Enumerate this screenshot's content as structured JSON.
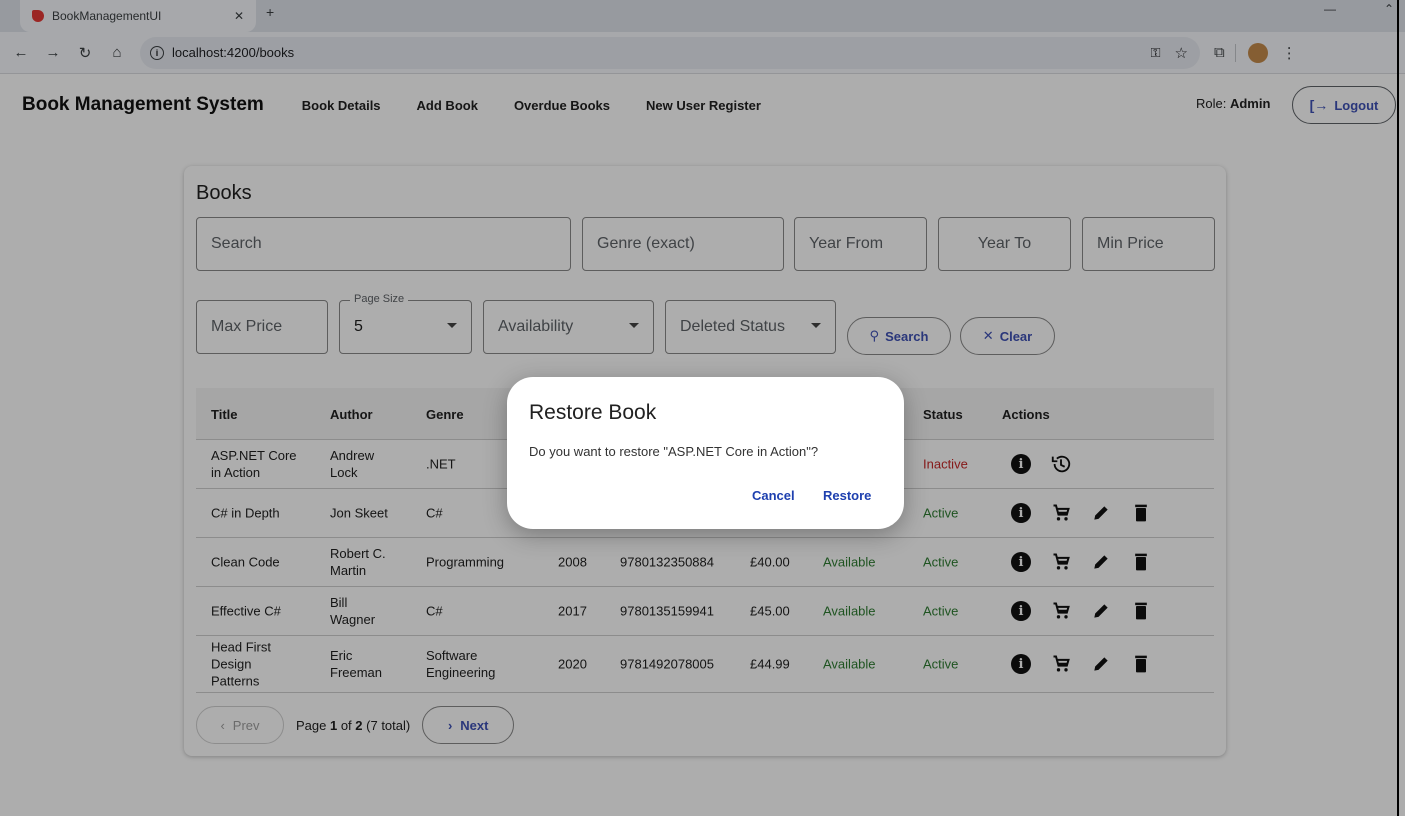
{
  "browser": {
    "tab_title": "BookManagementUI",
    "url": "localhost:4200/books"
  },
  "appbar": {
    "brand": "Book Management System",
    "nav": [
      "Book Details",
      "Add Book",
      "Overdue Books",
      "New User Register"
    ],
    "role_label": "Role: ",
    "role_value": "Admin",
    "logout_label": "Logout"
  },
  "filters": {
    "title": "Books",
    "search_placeholder": "Search",
    "genre_placeholder": "Genre (exact)",
    "year_from_placeholder": "Year From",
    "year_to_placeholder": "Year To",
    "min_price_placeholder": "Min Price",
    "max_price_placeholder": "Max Price",
    "page_size_label": "Page Size",
    "page_size_value": "5",
    "availability_placeholder": "Availability",
    "deleted_status_placeholder": "Deleted Status",
    "search_button": "Search",
    "clear_button": "Clear"
  },
  "table": {
    "headers": {
      "title": "Title",
      "author": "Author",
      "genre": "Genre",
      "status": "Status",
      "actions": "Actions"
    },
    "rows": [
      {
        "title": [
          "ASP.NET Core",
          "in Action"
        ],
        "author": [
          "Andrew",
          "Lock"
        ],
        "genre": [
          ".NET"
        ],
        "year": "",
        "isbn": "",
        "price": "",
        "availability": "",
        "status": "Inactive",
        "deleted": true
      },
      {
        "title": [
          "C# in Depth"
        ],
        "author": [
          "Jon Skeet"
        ],
        "genre": [
          "C#"
        ],
        "year": "",
        "isbn": "",
        "price": "",
        "availability": "",
        "status": "Active",
        "deleted": false
      },
      {
        "title": [
          "Clean Code"
        ],
        "author": [
          "Robert C.",
          "Martin"
        ],
        "genre": [
          "Programming"
        ],
        "year": "2008",
        "isbn": "9780132350884",
        "price": "£40.00",
        "availability": "Available",
        "status": "Active",
        "deleted": false
      },
      {
        "title": [
          "Effective C#"
        ],
        "author": [
          "Bill",
          "Wagner"
        ],
        "genre": [
          "C#"
        ],
        "year": "2017",
        "isbn": "9780135159941",
        "price": "£45.00",
        "availability": "Available",
        "status": "Active",
        "deleted": false
      },
      {
        "title": [
          "Head First",
          "Design",
          "Patterns"
        ],
        "author": [
          "Eric",
          "Freeman"
        ],
        "genre": [
          "Software",
          "Engineering"
        ],
        "year": "2020",
        "isbn": "9781492078005",
        "price": "£44.99",
        "availability": "Available",
        "status": "Active",
        "deleted": false
      }
    ]
  },
  "pager": {
    "prev_label": "Prev",
    "page_prefix": "Page ",
    "current_page": "1",
    "of_text": " of ",
    "total_pages": "2",
    "total_text": " (7 total)",
    "next_label": "Next"
  },
  "dialog": {
    "title": "Restore Book",
    "message": "Do you want to restore \"ASP.NET Core in Action\"?",
    "cancel_label": "Cancel",
    "restore_label": "Restore"
  },
  "colors": {
    "accent": "#3f51b5",
    "available": "#2e7d32",
    "inactive": "#c62828",
    "dialog_action": "#1e40af"
  },
  "icons": {
    "info": "info-icon",
    "restore": "restore-history-icon",
    "cart": "cart-icon",
    "edit": "pencil-icon",
    "delete": "trash-icon"
  }
}
